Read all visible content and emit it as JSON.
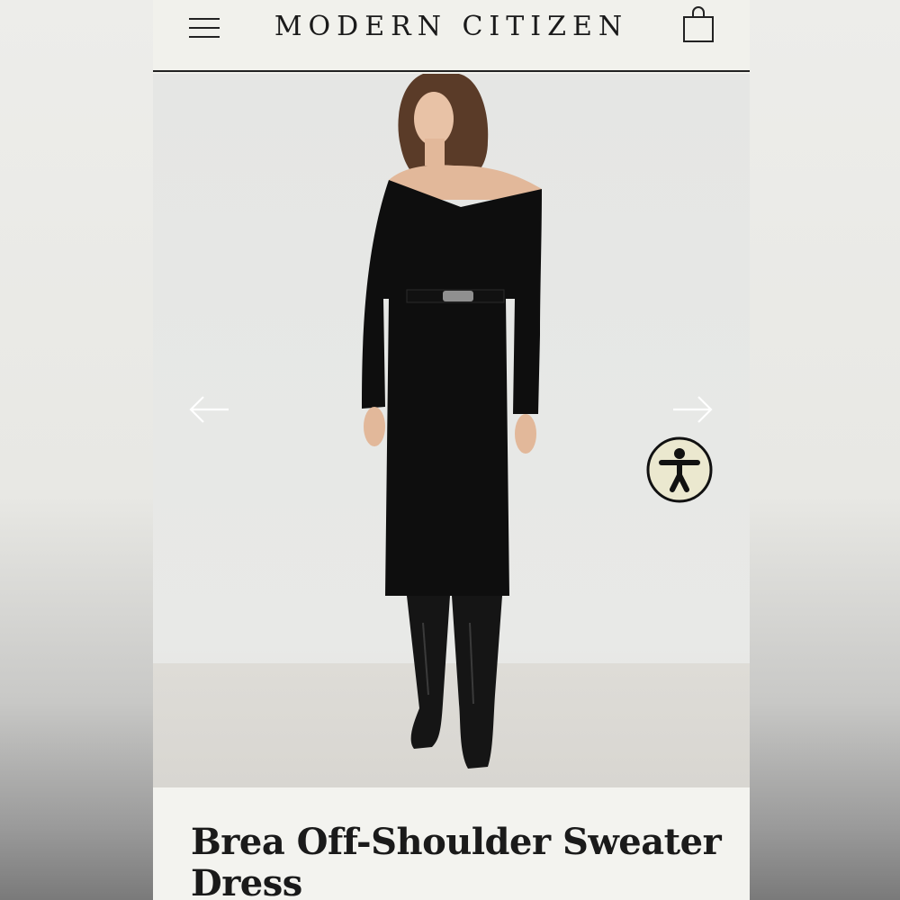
{
  "header": {
    "brand": "MODERN CITIZEN",
    "menu_icon": "hamburger-menu-icon",
    "bag_icon": "shopping-bag-icon"
  },
  "gallery": {
    "prev_icon": "arrow-left-icon",
    "next_icon": "arrow-right-icon",
    "accessibility_icon": "accessibility-person-icon"
  },
  "product": {
    "title": "Brea Off-Shoulder Sweater Dress"
  },
  "colors": {
    "page_bg": "#f1f1ec",
    "text": "#1a1a1a",
    "accessibility_bg": "#ebe8cf"
  }
}
